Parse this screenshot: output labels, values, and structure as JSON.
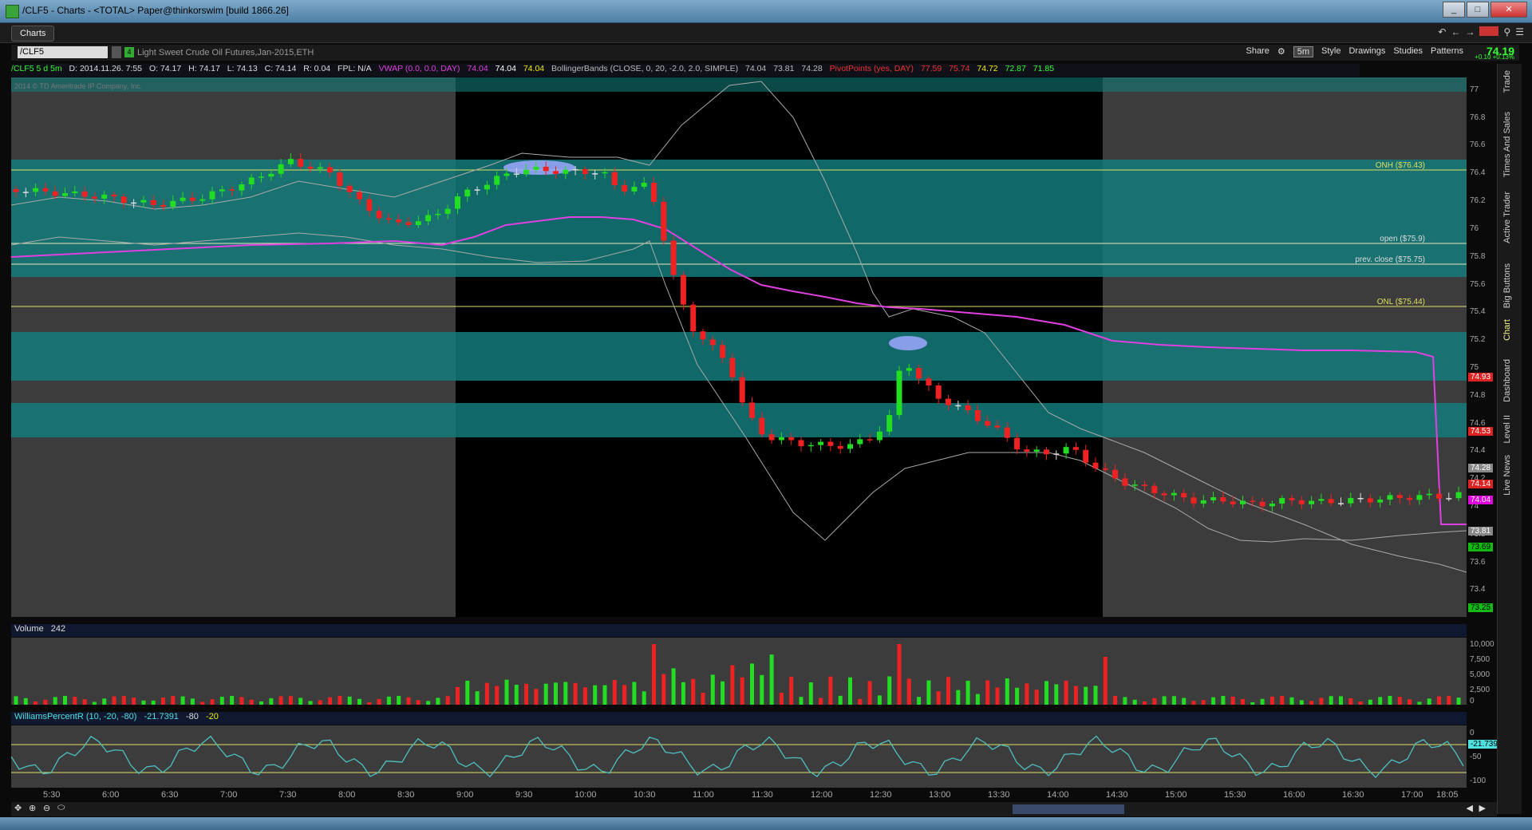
{
  "window": {
    "title": "/CLF5 - Charts - <TOTAL> Paper@thinkorswim [build 1866.26]",
    "min": "_",
    "max": "□",
    "close": "✕"
  },
  "tab": {
    "label": "Charts"
  },
  "toolbar": {
    "symbol": "/CLF5",
    "symbol_badge": "4",
    "description": "Light Sweet Crude Oil Futures,Jan-2015,ETH",
    "share": "Share",
    "timeframe": "5m",
    "style": "Style",
    "drawings": "Drawings",
    "studies": "Studies",
    "patterns": "Patterns",
    "last": "74.19",
    "change": "+0.10 +0.13%"
  },
  "studyline": {
    "sym": "/CLF5 5 d 5m",
    "date": "D: 2014.11.26. 7:55",
    "open": "O: 74.17",
    "high": "H: 74.17",
    "low": "L: 74.13",
    "close": "C: 74.14",
    "range": "R: 0.04",
    "fpl": "FPL: N/A",
    "vwap_label": "VWAP (0.0, 0.0, DAY)",
    "vwap_v1": "74.04",
    "vwap_v2": "74.04",
    "vwap_v3": "74.04",
    "bb_label": "BollingerBands (CLOSE, 0, 20, -2.0, 2.0, SIMPLE)",
    "bb_v1": "74.04",
    "bb_v2": "73.81",
    "bb_v3": "74.28",
    "pp_label": "PivotPoints (yes, DAY)",
    "pp_v1": "77.59",
    "pp_v2": "75.74",
    "pp_v3": "74.72",
    "pp_v4": "72.87",
    "pp_v5": "71.85"
  },
  "copyright": "2014 © TD Ameritrade IP Company, Inc.",
  "price_lines": {
    "onh": "ONH ($76.43)",
    "open": "open ($75.9)",
    "prev_close": "prev. close ($75.75)",
    "onl": "ONL ($75.44)"
  },
  "y_labels": [
    "77",
    "76.8",
    "76.6",
    "76.4",
    "76.2",
    "76",
    "75.8",
    "75.6",
    "75.4",
    "75.2",
    "75",
    "74.8",
    "74.6",
    "74.4",
    "74.2",
    "74",
    "73.8",
    "73.6",
    "73.4",
    "73.2"
  ],
  "price_tags": {
    "t1": "74.93",
    "t2": "74.53",
    "t3": "74.28",
    "t4": "74.14",
    "t5": "74.04",
    "t6": "73.81",
    "t7": "73.69",
    "t8": "73.25"
  },
  "volume": {
    "label": "Volume",
    "value": "242",
    "y_labels": [
      "10,000",
      "7,500",
      "5,000",
      "2,500",
      "0"
    ]
  },
  "williams": {
    "label": "WilliamsPercentR (10, -20, -80)",
    "value": "-21.7391",
    "lo": "-80",
    "hi": "-20",
    "y_labels": [
      "0",
      "-50",
      "-100"
    ],
    "tag": "-21.739"
  },
  "x_labels": [
    "5:30",
    "6:00",
    "6:30",
    "7:00",
    "7:30",
    "8:00",
    "8:30",
    "9:00",
    "9:30",
    "10:00",
    "10:30",
    "11:00",
    "11:30",
    "12:00",
    "12:30",
    "13:00",
    "13:30",
    "14:00",
    "14:30",
    "15:00",
    "15:30",
    "16:00",
    "16:30",
    "17:00",
    "18:05"
  ],
  "right_tabs": [
    "Trade",
    "Times And Sales",
    "Active Trader",
    "Big Buttons",
    "Chart",
    "Dashboard",
    "Level II",
    "Live News"
  ],
  "colors": {
    "up": "#22dd22",
    "down": "#ee2222",
    "teal": "#137a7a",
    "vwap": "#e040e0",
    "bb": "#9a9a9a",
    "pivot": "#e0e060"
  }
}
